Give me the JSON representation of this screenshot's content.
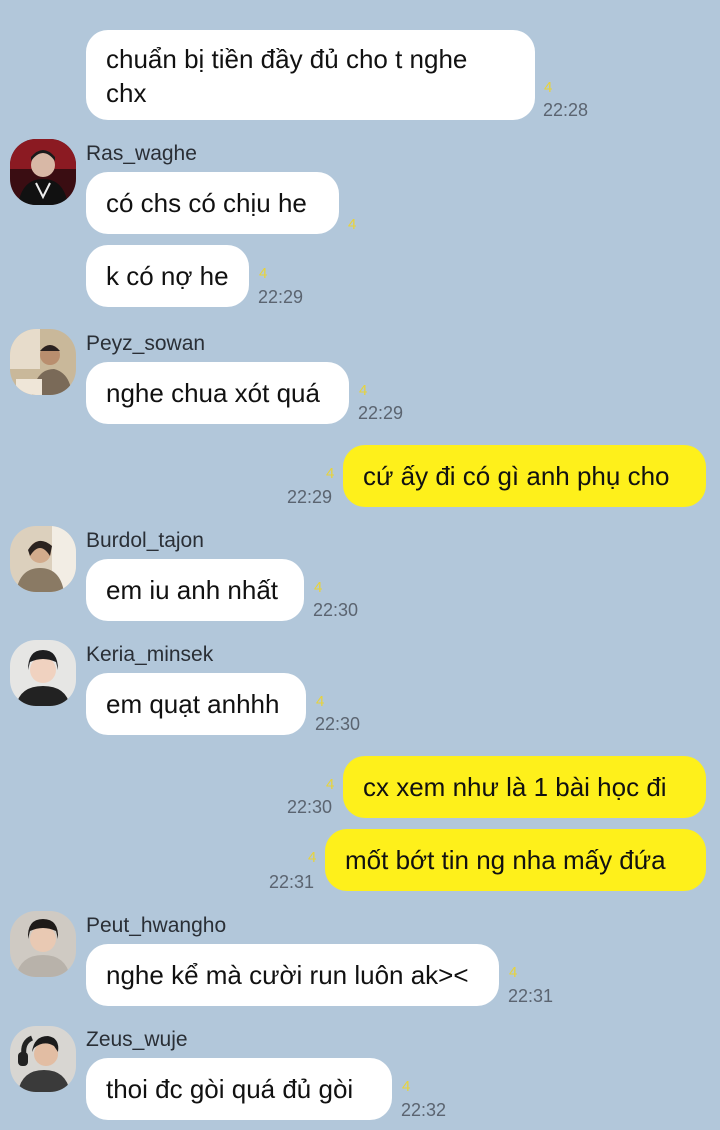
{
  "chat": {
    "messages": [
      {
        "sender": "",
        "text": "chuẩn bị tiền đầy đủ cho t nghe chx",
        "unread": "4",
        "time": "22:28"
      },
      {
        "sender": "Ras_waghe",
        "text": "có chs có chịu he",
        "unread": "4",
        "time": ""
      },
      {
        "sender": "",
        "text": "k có nợ he",
        "unread": "4",
        "time": "22:29"
      },
      {
        "sender": "Peyz_sowan",
        "text": "nghe chua xót quá",
        "unread": "4",
        "time": "22:29"
      },
      {
        "sender": "me",
        "text": "cứ ấy đi có gì anh phụ cho",
        "unread": "4",
        "time": "22:29"
      },
      {
        "sender": "Burdol_tajon",
        "text": "em iu anh nhất",
        "unread": "4",
        "time": "22:30"
      },
      {
        "sender": "Keria_minsek",
        "text": "em quạt anhhh",
        "unread": "4",
        "time": "22:30"
      },
      {
        "sender": "me",
        "text": "cx xem như là 1 bài học đi",
        "unread": "4",
        "time": "22:30"
      },
      {
        "sender": "me",
        "text": "mốt bớt tin ng nha mấy đứa",
        "unread": "4",
        "time": "22:31"
      },
      {
        "sender": "Peut_hwangho",
        "text": "nghe kể mà cười run luôn ak><",
        "unread": "4",
        "time": "22:31"
      },
      {
        "sender": "Zeus_wuje",
        "text": "thoi đc gòi quá đủ gòi",
        "unread": "4",
        "time": "22:32"
      }
    ]
  },
  "colors": {
    "background": "#b2c7da",
    "incoming_bubble": "#ffffff",
    "outgoing_bubble": "#fef01b",
    "unread_count": "#e8d33a"
  }
}
